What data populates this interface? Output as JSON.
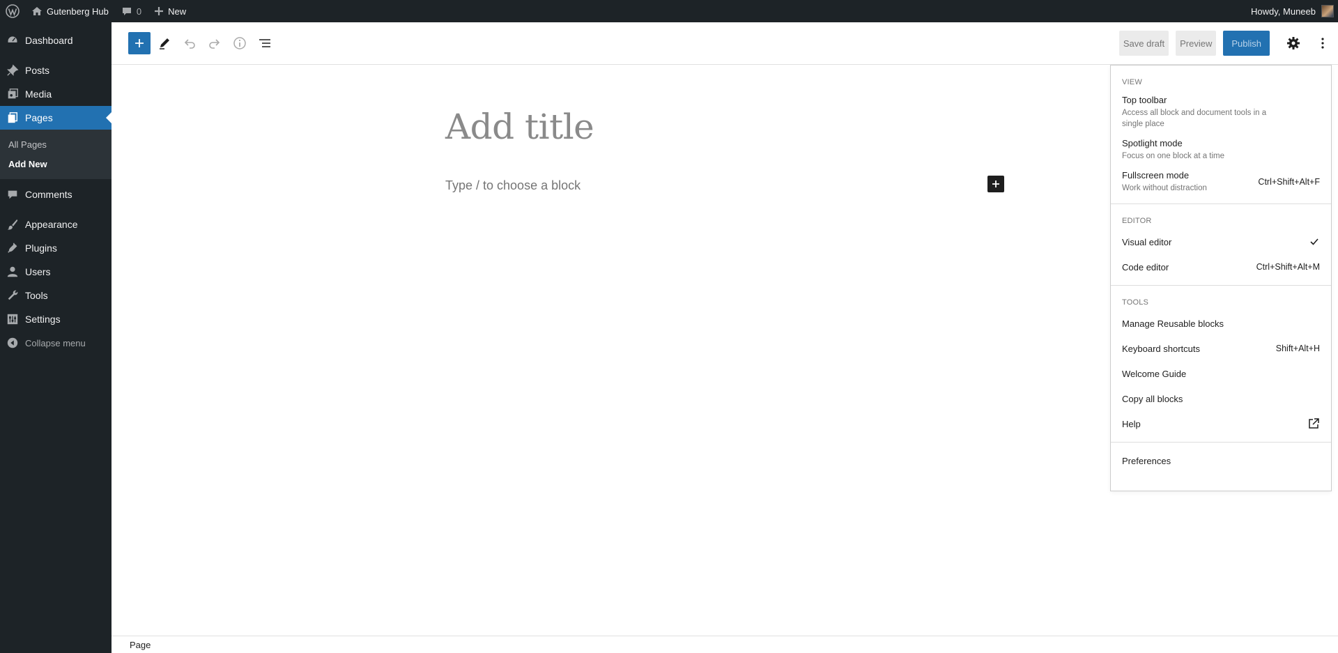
{
  "adminbar": {
    "site_name": "Gutenberg Hub",
    "comments_count": "0",
    "new_label": "New",
    "howdy": "Howdy, Muneeb"
  },
  "sidebar": {
    "items": [
      {
        "label": "Dashboard",
        "icon": "dashboard-icon"
      },
      {
        "label": "Posts",
        "icon": "pin-icon"
      },
      {
        "label": "Media",
        "icon": "media-icon"
      },
      {
        "label": "Pages",
        "icon": "pages-icon",
        "active": true
      },
      {
        "label": "Comments",
        "icon": "comment-icon"
      },
      {
        "label": "Appearance",
        "icon": "brush-icon"
      },
      {
        "label": "Plugins",
        "icon": "plug-icon"
      },
      {
        "label": "Users",
        "icon": "user-icon"
      },
      {
        "label": "Tools",
        "icon": "wrench-icon"
      },
      {
        "label": "Settings",
        "icon": "settings-icon"
      }
    ],
    "pages_submenu": [
      "All Pages",
      "Add New"
    ],
    "collapse_label": "Collapse menu"
  },
  "header": {
    "save_draft": "Save draft",
    "preview": "Preview",
    "publish": "Publish"
  },
  "canvas": {
    "title_placeholder": "Add title",
    "block_placeholder": "Type / to choose a block"
  },
  "footer": {
    "breadcrumb": "Page"
  },
  "dropdown": {
    "view": {
      "label": "View",
      "items": [
        {
          "label": "Top toolbar",
          "help": "Access all block and document tools in a single place",
          "shortcut": ""
        },
        {
          "label": "Spotlight mode",
          "help": "Focus on one block at a time",
          "shortcut": ""
        },
        {
          "label": "Fullscreen mode",
          "help": "Work without distraction",
          "shortcut": "Ctrl+Shift+Alt+F"
        }
      ]
    },
    "editor": {
      "label": "Editor",
      "items": [
        {
          "label": "Visual editor",
          "shortcut": "",
          "checked": true
        },
        {
          "label": "Code editor",
          "shortcut": "Ctrl+Shift+Alt+M"
        }
      ]
    },
    "tools": {
      "label": "Tools",
      "items": [
        {
          "label": "Manage Reusable blocks",
          "shortcut": ""
        },
        {
          "label": "Keyboard shortcuts",
          "shortcut": "Shift+Alt+H"
        },
        {
          "label": "Welcome Guide",
          "shortcut": ""
        },
        {
          "label": "Copy all blocks",
          "shortcut": ""
        },
        {
          "label": "Help",
          "shortcut": "",
          "icon": "external-link-icon"
        }
      ]
    },
    "preferences": "Preferences"
  },
  "colors": {
    "admin_dark": "#1d2327",
    "accent": "#2271b1",
    "submenu_bg": "#2c3338"
  }
}
